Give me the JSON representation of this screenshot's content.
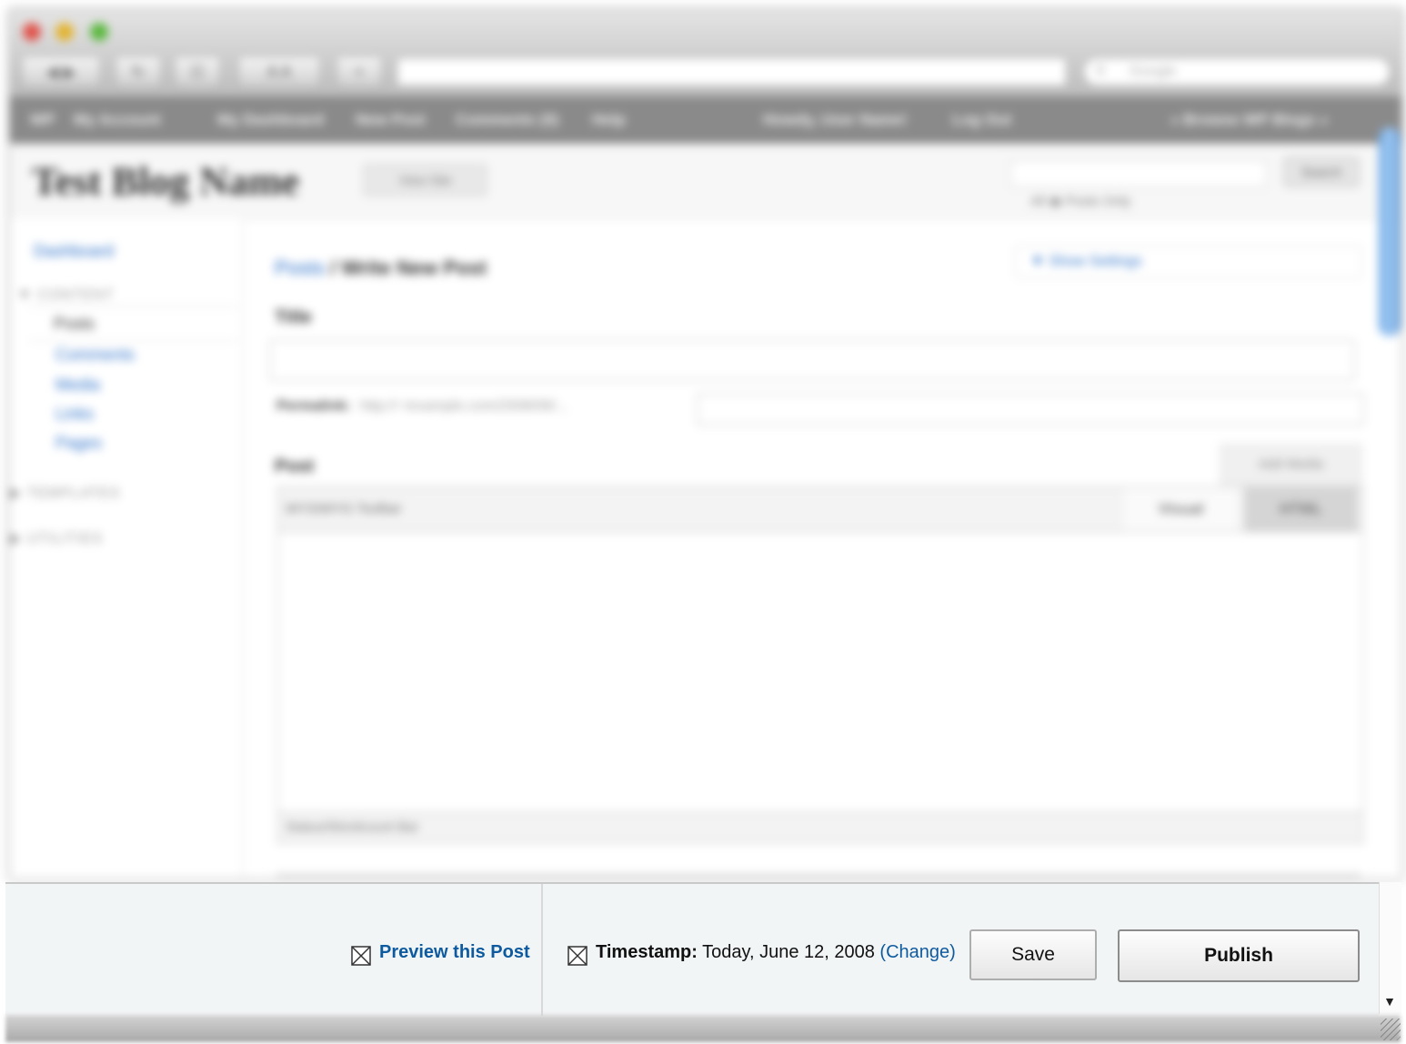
{
  "browser": {
    "nav_back": "◀",
    "nav_forward": "▶",
    "reload": "↻",
    "bookmarks": "☷",
    "zoom": "A A",
    "add": "+",
    "search_placeholder": "Google"
  },
  "admin_bar": {
    "wp": "WP",
    "my_account": "My Account",
    "my_dashboard": "My Dashboard",
    "new_post": "New Post",
    "comments": "Comments (0)",
    "help": "Help",
    "howdy": "Howdy, User Name!",
    "log_out": "Log Out",
    "browse": "« Browse WP Blogs »"
  },
  "header": {
    "blog_name": "Test Blog Name",
    "view_site": "View Site",
    "search_button": "Search",
    "search_sub": "All  ◉ Posts Only"
  },
  "sidebar": {
    "dashboard": "Dashboard",
    "content_heading": "CONTENT",
    "posts": "Posts",
    "comments": "Comments",
    "media": "Media",
    "links": "Links",
    "pages": "Pages",
    "templates_heading": "TEMPLATES",
    "utilities_heading": "UTILITIES"
  },
  "main": {
    "breadcrumb_link": "Posts",
    "breadcrumb_sep": " / ",
    "breadcrumb_current": "Write New Post",
    "show_settings": "▼ Show Settings",
    "title_label": "Title",
    "permalink_label": "Permalink:",
    "permalink_url": "http://~/example.com/2008/06/...",
    "post_label": "Post",
    "add_media": "Add Media",
    "toolbar_label": "WYSIWYG Toolbar",
    "tab_visual": "Visual",
    "tab_html": "HTML",
    "status_bar": "Status/Wordcount Bar"
  },
  "publish_bar": {
    "preview_link": "Preview this Post",
    "timestamp_label": "Timestamp:",
    "timestamp_value": " Today, June 12, 2008 ",
    "timestamp_change": "(Change)",
    "save_button": "Save",
    "publish_button": "Publish"
  },
  "scrollbar": {
    "down_arrow": "▼"
  },
  "colors": {
    "link_blue": "#0e5a9f",
    "bar_background": "#f2f5f6",
    "admin_bar": "#8a8a8a"
  },
  "icons": {
    "preview_checkbox": "x-box-icon",
    "timestamp_checkbox": "x-box-icon"
  }
}
